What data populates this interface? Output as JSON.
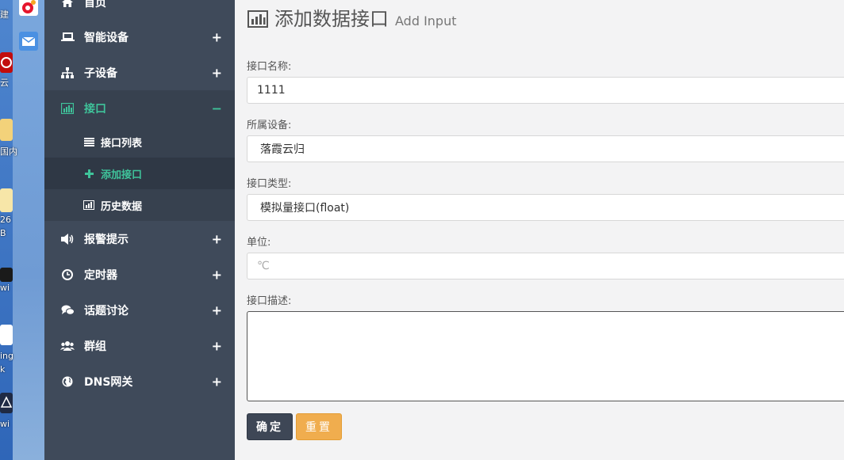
{
  "desktop": {
    "labels": [
      "建",
      "云",
      "国内",
      "26",
      "B",
      "wi",
      "ing",
      "k",
      "wi"
    ]
  },
  "sidebar": {
    "items": [
      {
        "label": "首页",
        "toggle": ""
      },
      {
        "label": "智能设备",
        "toggle": "+"
      },
      {
        "label": "子设备",
        "toggle": "+"
      },
      {
        "label": "接口",
        "toggle": "−"
      },
      {
        "label": "报警提示",
        "toggle": "+"
      },
      {
        "label": "定时器",
        "toggle": "+"
      },
      {
        "label": "话题讨论",
        "toggle": "+"
      },
      {
        "label": "群组",
        "toggle": "+"
      },
      {
        "label": "DNS网关",
        "toggle": "+"
      }
    ],
    "subitems": [
      {
        "label": "接口列表"
      },
      {
        "label": "添加接口"
      },
      {
        "label": "历史数据"
      }
    ]
  },
  "page": {
    "title": "添加数据接口",
    "subtitle": "Add Input"
  },
  "form": {
    "name_label": "接口名称:",
    "name_value": "1111",
    "device_label": "所属设备:",
    "device_value": "落霞云归",
    "type_label": "接口类型:",
    "type_value": "模拟量接口(float)",
    "unit_label": "单位:",
    "unit_placeholder": "℃",
    "desc_label": "接口描述:",
    "desc_value": ""
  },
  "buttons": {
    "submit": "确定",
    "reset": "重置"
  },
  "colors": {
    "sidebar_bg": "#3f4a5a",
    "active_green": "#3fc39a",
    "submit_bg": "#3e4756",
    "reset_bg": "#f0ad4e"
  }
}
